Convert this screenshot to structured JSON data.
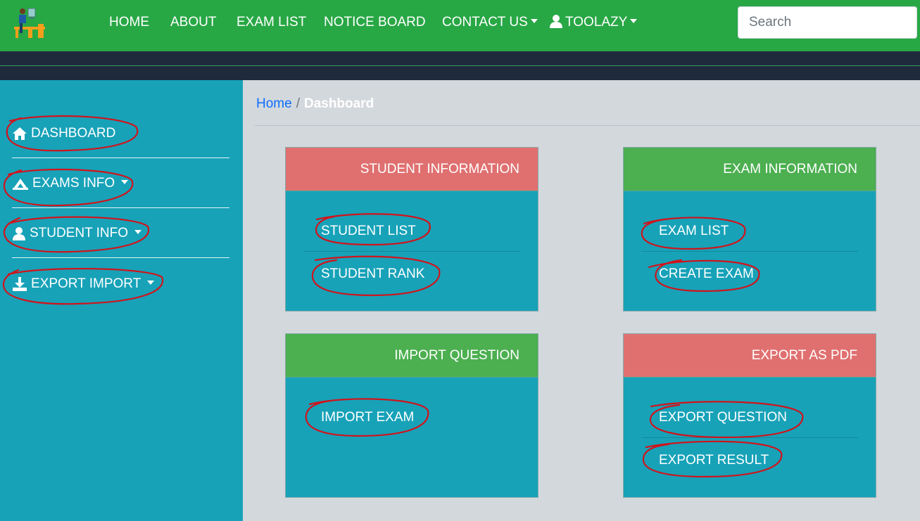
{
  "navbar": {
    "items": [
      "HOME",
      "ABOUT",
      "EXAM LIST",
      "NOTICE BOARD",
      "CONTACT US"
    ],
    "user": "TOOLAZY",
    "search_placeholder": "Search",
    "icons": [
      "logo-icon",
      "caret-down-icon",
      "user-icon"
    ]
  },
  "sidebar": {
    "items": [
      {
        "label": "DASHBOARD",
        "icon": "home-icon"
      },
      {
        "label": "EXAMS INFO",
        "icon": "exam-icon",
        "dropdown": true
      },
      {
        "label": "STUDENT INFO",
        "icon": "user-icon",
        "dropdown": true
      },
      {
        "label": "EXPORT IMPORT",
        "icon": "download-icon",
        "dropdown": true
      }
    ]
  },
  "breadcrumb": {
    "home": "Home",
    "sep": "/",
    "current": "Dashboard"
  },
  "cards": [
    {
      "title": "STUDENT INFORMATION",
      "color": "#e07070",
      "links": [
        "STUDENT LIST",
        "STUDENT RANK"
      ]
    },
    {
      "title": "EXAM INFORMATION",
      "color": "#4caf50",
      "links": [
        "EXAM LIST",
        "CREATE EXAM"
      ]
    },
    {
      "title": "IMPORT QUESTION",
      "color": "#4caf50",
      "links": [
        "IMPORT EXAM"
      ]
    },
    {
      "title": "EXPORT AS PDF",
      "color": "#e07070",
      "links": [
        "EXPORT QUESTION",
        "EXPORT RESULT"
      ]
    }
  ],
  "colors": {
    "navbar": "#28a745",
    "sidebar": "#17a2b8",
    "strip": "#1f2a3c",
    "annotation": "#d0141c"
  }
}
